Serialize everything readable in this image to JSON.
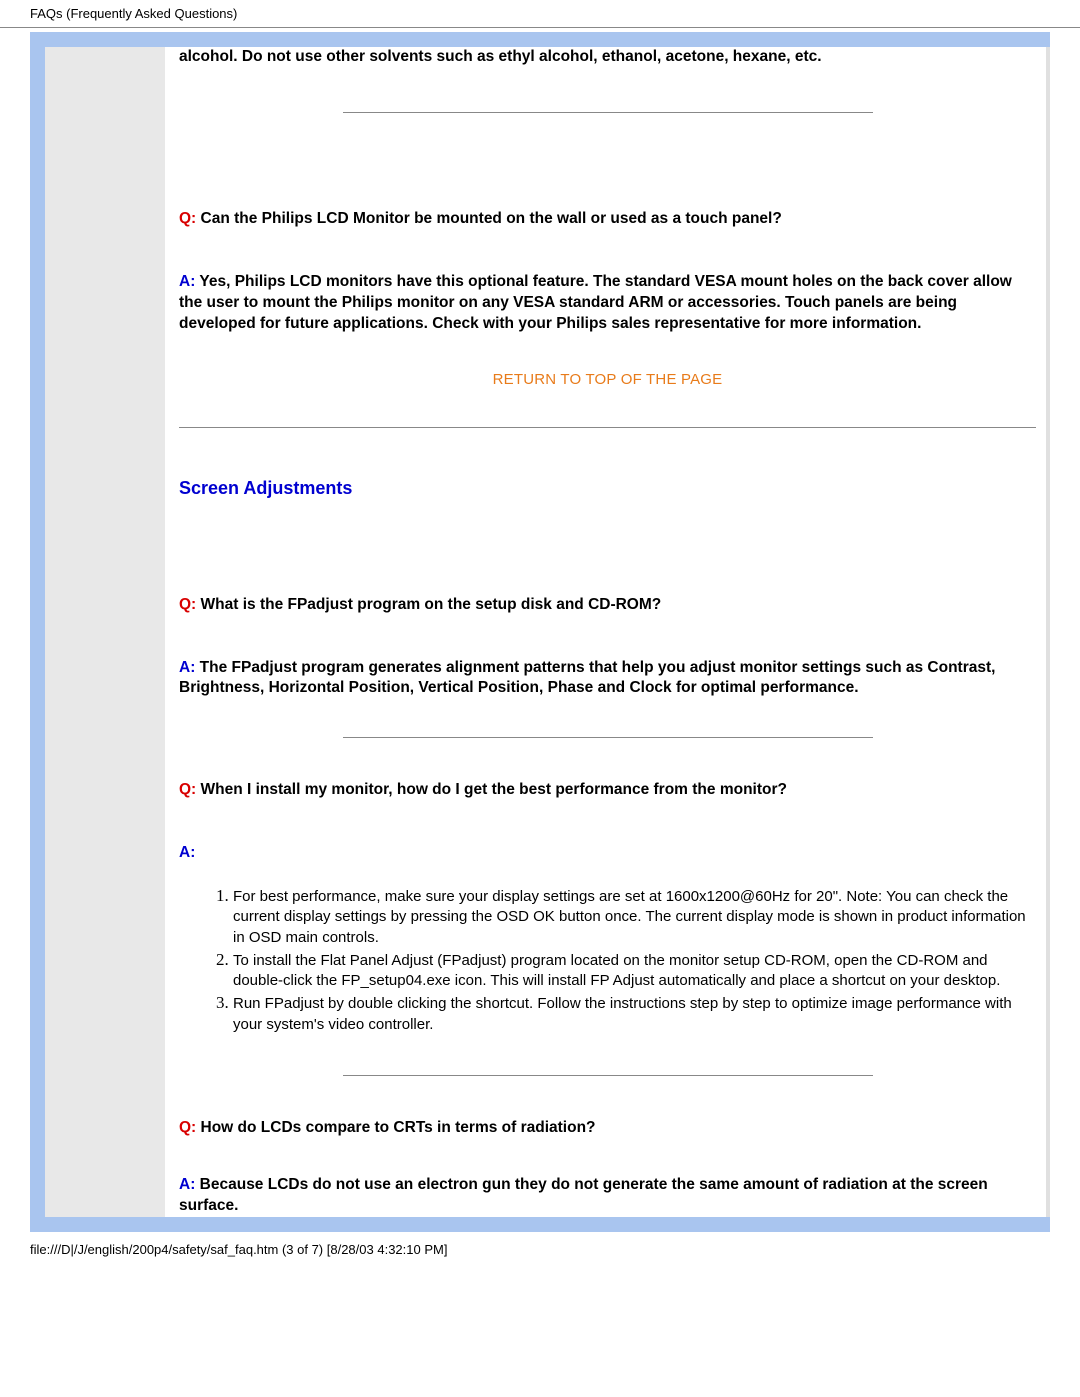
{
  "header": {
    "title": "FAQs (Frequently Asked Questions)"
  },
  "top_fragment": "alcohol. Do not use other solvents such as ethyl alcohol, ethanol, acetone, hexane, etc.",
  "qa1": {
    "q_label": "Q:",
    "q_text": " Can the Philips LCD Monitor be mounted on the wall or used as a touch panel?",
    "a_label": "A:",
    "a_text": " Yes, Philips LCD monitors have this optional feature. The standard VESA mount holes on the back cover allow the user to mount the Philips monitor on any VESA standard ARM or accessories. Touch panels are being developed for future applications. Check with your Philips sales representative for more information."
  },
  "return_link": "RETURN TO TOP OF THE PAGE",
  "section_heading": "Screen Adjustments",
  "qa2": {
    "q_label": "Q:",
    "q_text": " What is the FPadjust program on the setup disk and CD-ROM?",
    "a_label": "A:",
    "a_text": " The FPadjust program generates alignment patterns that help you adjust monitor settings such as Contrast, Brightness, Horizontal Position, Vertical Position, Phase and Clock for optimal performance."
  },
  "qa3": {
    "q_label": "Q:",
    "q_text": " When I install my monitor, how do I get the best performance from the monitor?",
    "a_label": "A:"
  },
  "steps": [
    "For best performance, make sure your display settings are set at 1600x1200@60Hz for 20\". Note: You can check the current display settings by pressing the OSD OK button once.\nThe current display mode is shown in product information in OSD main controls.",
    "To install the Flat Panel Adjust (FPadjust) program located on the monitor setup CD-ROM, open the CD-ROM and double-click the FP_setup04.exe icon. This will install FP Adjust automatically and place a shortcut on your desktop.",
    "Run FPadjust by double clicking the shortcut. Follow the instructions step by step to optimize image performance with your system's video controller."
  ],
  "qa4": {
    "q_label": "Q:",
    "q_text": " How do LCDs compare to CRTs in terms of radiation?",
    "a_label": "A:",
    "a_text": " Because LCDs do not use an electron gun they do not generate the same amount of radiation at the screen surface."
  },
  "footer": {
    "path": "file:///D|/J/english/200p4/safety/saf_faq.htm (3 of 7) [8/28/03 4:32:10 PM]"
  }
}
